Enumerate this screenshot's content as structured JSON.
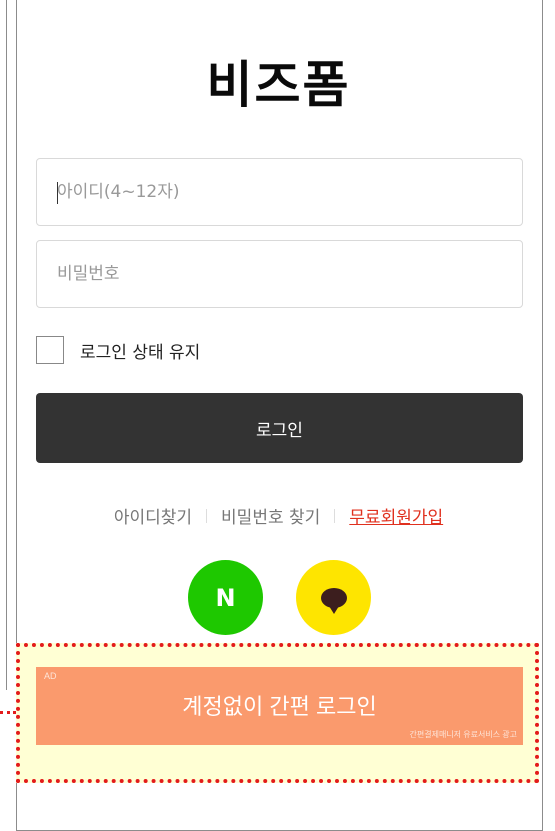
{
  "header": {
    "title": "비즈폼"
  },
  "form": {
    "id_placeholder": "아이디(4~12자)",
    "password_placeholder": "비밀번호",
    "keep_login_label": "로그인 상태 유지",
    "login_button": "로그인"
  },
  "links": {
    "find_id": "아이디찾기",
    "find_password": "비밀번호 찾기",
    "signup": "무료회원가입"
  },
  "social": {
    "naver_letter": "N",
    "naver_icon": "naver-n-icon",
    "kakao_icon": "kakao-speech-bubble-icon"
  },
  "ad": {
    "tag": "AD",
    "button_text": "계정없이 간편 로그인",
    "sub_text": "간편결제매니저 유료서비스 광고"
  },
  "colors": {
    "login_button": "#333333",
    "signup_link": "#e0301e",
    "naver": "#1ec800",
    "kakao": "#fee500",
    "ad_button": "#fa9a6d",
    "ad_highlight_border": "#e31b1b",
    "ad_highlight_bg": "#ffffd4"
  }
}
